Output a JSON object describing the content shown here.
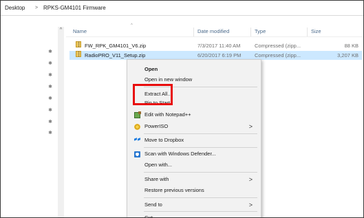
{
  "breadcrumb": [
    "Desktop",
    "RPKS-GM4101 Firmware"
  ],
  "breadcrumb_separator": ">",
  "nav": {
    "scroll_up": "^",
    "pin_glyph": "✱"
  },
  "columns": {
    "name": "Name",
    "date": "Date modified",
    "type": "Type",
    "size": "Size",
    "sort_indicator": "^"
  },
  "files": [
    {
      "name": "FW_RPK_GM4101_V6.zip",
      "date": "7/3/2017 11:40 AM",
      "type": "Compressed (zipp...",
      "size": "88 KB",
      "selected": false,
      "icon": "zip-folder-icon"
    },
    {
      "name": "RadioPRO_V11_Setup.zip",
      "date": "6/20/2017 6:19 PM",
      "type": "Compressed (zipp...",
      "size": "3,207 KB",
      "selected": true,
      "icon": "zip-folder-icon"
    }
  ],
  "context_menu": {
    "open": "Open",
    "open_new_window": "Open in new window",
    "extract_all": "Extract All...",
    "pin_to_start": "Pin to Start",
    "edit_notepad": "Edit with Notepad++",
    "poweriso": "PowerISO",
    "dropbox": "Move to Dropbox",
    "defender": "Scan with Windows Defender...",
    "open_with": "Open with...",
    "share_with": "Share with",
    "restore": "Restore previous versions",
    "send_to": "Send to",
    "cut": "Cut",
    "submenu_arrow": ">"
  },
  "colors": {
    "highlight": "#e80c0c",
    "selection": "#cce8ff",
    "menu_bg": "#f2f2f2"
  }
}
